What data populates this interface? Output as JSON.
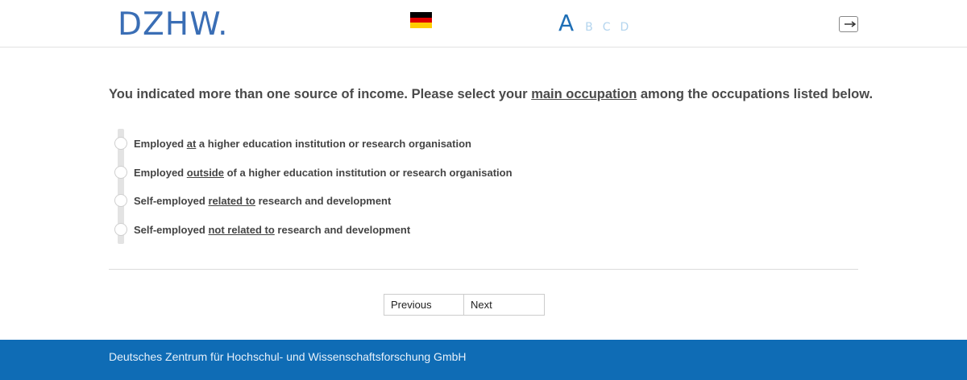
{
  "header": {
    "logo_text": "DZHW",
    "logo_dot": ".",
    "language_flag": "de-flag-icon",
    "font_sizes": [
      "A",
      "B",
      "C",
      "D"
    ],
    "logout_icon": "logout-icon"
  },
  "question": {
    "pre": "You indicated more than one source of income. Please select your ",
    "emphasis": "main occupation",
    "post": " among the occupations listed below."
  },
  "options": [
    {
      "pre": "Employed ",
      "emphasis": "at",
      "post": " a higher education institution or research organisation"
    },
    {
      "pre": "Employed ",
      "emphasis": "outside",
      "post": " of a higher education institution or research organisation"
    },
    {
      "pre": "Self-employed ",
      "emphasis": "related to",
      "post": " research and development"
    },
    {
      "pre": "Self-employed ",
      "emphasis": "not related to",
      "post": " research and development"
    }
  ],
  "navigation": {
    "previous_label": "Previous",
    "next_label": "Next"
  },
  "footer": {
    "text": "Deutsches Zentrum für Hochschul- und Wissenschaftsforschung GmbH"
  },
  "colors": {
    "brand_blue": "#0f6cb5",
    "logo_blue": "#3a6eb5"
  }
}
